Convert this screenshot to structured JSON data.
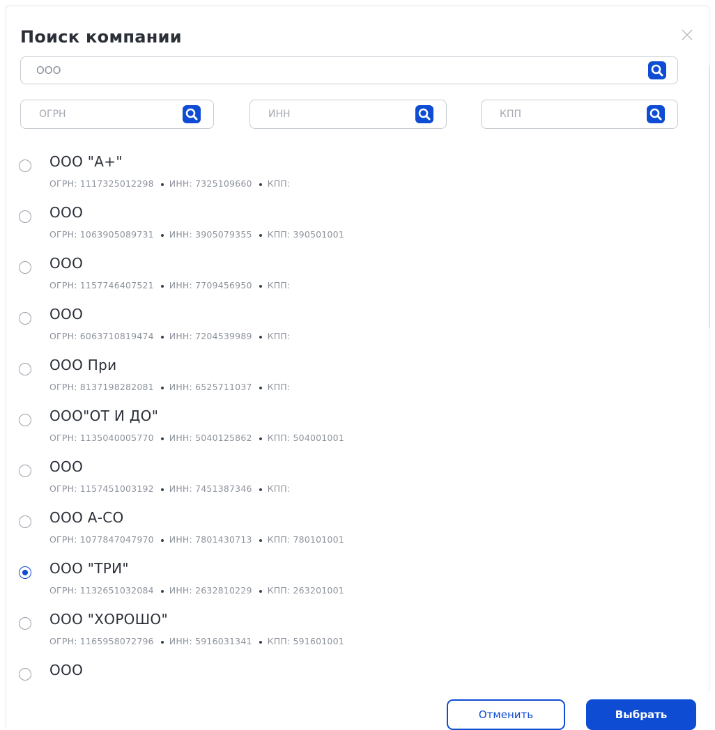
{
  "dialog": {
    "title": "Поиск компании",
    "close_icon": "close-icon"
  },
  "search": {
    "value": "ООО",
    "icon": "search-icon",
    "accent_color": "#0d4cd3"
  },
  "filters": [
    {
      "placeholder": "ОГРН"
    },
    {
      "placeholder": "ИНН"
    },
    {
      "placeholder": "КПП"
    }
  ],
  "results": [
    {
      "name": "ООО \"А+\"",
      "ogrn": "ОГРН: 1117325012298",
      "inn": "ИНН: 7325109660",
      "kpp": "КПП:",
      "selected": false
    },
    {
      "name": "ООО",
      "ogrn": "ОГРН: 1063905089731",
      "inn": "ИНН: 3905079355",
      "kpp": "КПП: 390501001",
      "selected": false
    },
    {
      "name": "ООО",
      "ogrn": "ОГРН: 1157746407521",
      "inn": "ИНН: 7709456950",
      "kpp": "КПП:",
      "selected": false
    },
    {
      "name": "ООО",
      "ogrn": "ОГРН: 6063710819474",
      "inn": "ИНН: 7204539989",
      "kpp": "КПП:",
      "selected": false
    },
    {
      "name": "ООО При",
      "ogrn": "ОГРН: 8137198282081",
      "inn": "ИНН: 6525711037",
      "kpp": "КПП:",
      "selected": false
    },
    {
      "name": "ООО\"ОТ И ДО\"",
      "ogrn": "ОГРН: 1135040005770",
      "inn": "ИНН: 5040125862",
      "kpp": "КПП: 504001001",
      "selected": false
    },
    {
      "name": "ООО",
      "ogrn": "ОГРН: 1157451003192",
      "inn": "ИНН: 7451387346",
      "kpp": "КПП:",
      "selected": false
    },
    {
      "name": "ООО А-СО",
      "ogrn": "ОГРН: 1077847047970",
      "inn": "ИНН: 7801430713",
      "kpp": "КПП: 780101001",
      "selected": false
    },
    {
      "name": "ООО \"ТРИ\"",
      "ogrn": "ОГРН: 1132651032084",
      "inn": "ИНН: 2632810229",
      "kpp": "КПП: 263201001",
      "selected": true
    },
    {
      "name": "ООО \"ХОРОШО\"",
      "ogrn": "ОГРН: 1165958072796",
      "inn": "ИНН: 5916031341",
      "kpp": "КПП: 591601001",
      "selected": false
    },
    {
      "name": "ООО",
      "ogrn": "",
      "inn": "",
      "kpp": "",
      "selected": false
    }
  ],
  "footer": {
    "cancel_label": "Отменить",
    "select_label": "Выбрать"
  }
}
